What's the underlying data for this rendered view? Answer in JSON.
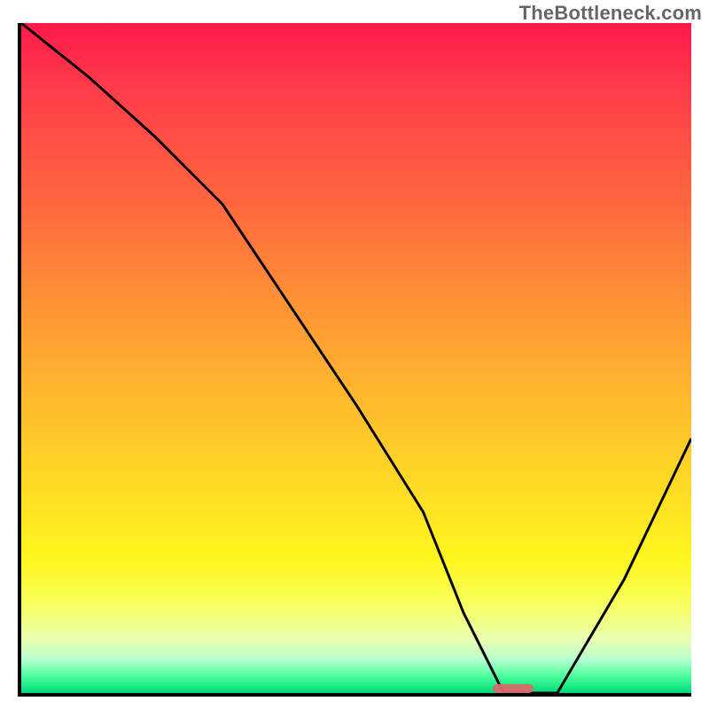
{
  "watermark": "TheBottleneck.com",
  "colors": {
    "top": "#ff1a4b",
    "mid_orange": "#ff9335",
    "mid_yellow": "#ffdc24",
    "bottom_green": "#00d878",
    "curve": "#000000",
    "marker": "#d96a6a"
  },
  "chart_data": {
    "type": "line",
    "title": "",
    "xlabel": "",
    "ylabel": "",
    "xlim": [
      0,
      100
    ],
    "ylim": [
      0,
      100
    ],
    "grid": false,
    "legend": false,
    "series": [
      {
        "name": "bottleneck-curve",
        "x": [
          0,
          10,
          20,
          30,
          40,
          50,
          60,
          66,
          72,
          80,
          90,
          100
        ],
        "y": [
          100,
          92,
          83,
          73,
          58,
          43,
          27,
          12,
          0,
          0,
          17,
          38
        ]
      }
    ],
    "marker": {
      "x_start": 70,
      "x_end": 76,
      "y": 0
    }
  }
}
